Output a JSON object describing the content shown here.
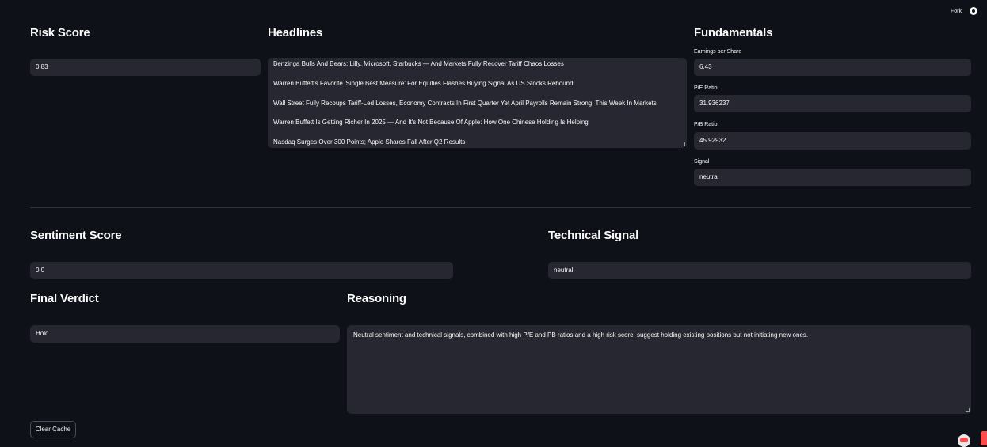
{
  "topbar": {
    "fork_label": "Fork",
    "github_icon": "github-icon"
  },
  "risk_score": {
    "heading": "Risk Score",
    "value": "0.83"
  },
  "headlines": {
    "heading": "Headlines",
    "items": [
      "Benzinga Bulls And Bears: Lilly, Microsoft, Starbucks — And Markets Fully Recover Tariff Chaos Losses",
      "Warren Buffett's Favorite 'Single Best Measure' For Equities Flashes Buying Signal As US Stocks Rebound",
      "Wall Street Fully Recoups Tariff-Led Losses, Economy Contracts In First Quarter Yet April Payrolls Remain Strong: This Week In Markets",
      "Warren Buffett Is Getting Richer In 2025 — And It's Not Because Of Apple: How One Chinese Holding Is Helping",
      "Nasdaq Surges Over 300 Points; Apple Shares Fall After Q2 Results"
    ]
  },
  "fundamentals": {
    "heading": "Fundamentals",
    "eps_label": "Earnings per Share",
    "eps_value": "6.43",
    "pe_label": "P/E Ratio",
    "pe_value": "31.936237",
    "pb_label": "P/B Ratio",
    "pb_value": "45.92932",
    "signal_label": "Signal",
    "signal_value": "neutral"
  },
  "sentiment": {
    "heading": "Sentiment Score",
    "value": "0.0"
  },
  "technical": {
    "heading": "Technical Signal",
    "value": "neutral"
  },
  "verdict": {
    "heading": "Final Verdict",
    "value": "Hold"
  },
  "reasoning": {
    "heading": "Reasoning",
    "text": "Neutral sentiment and technical signals, combined with high P/E and PB ratios and a high risk score, suggest holding existing positions but not initiating new ones."
  },
  "clear_cache_label": "Clear Cache",
  "colors": {
    "background": "#0e1118",
    "field": "#262730",
    "accent": "#ff4b4b"
  }
}
